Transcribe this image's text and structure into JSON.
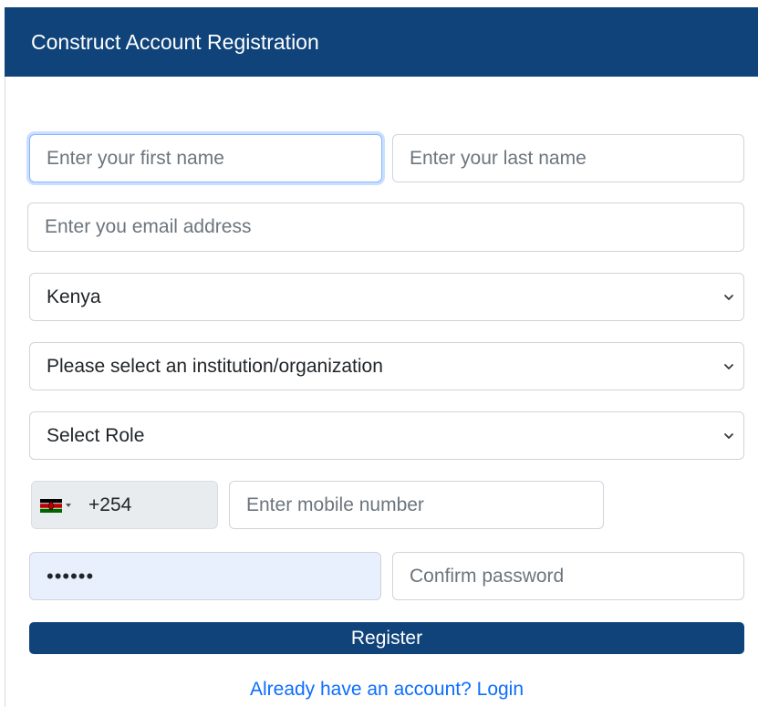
{
  "header": {
    "title": "Construct Account Registration"
  },
  "form": {
    "first_name_placeholder": "Enter your first name",
    "last_name_placeholder": "Enter your last name",
    "email_placeholder": "Enter you email address",
    "country_selected": "Kenya",
    "institution_selected": "Please select an institution/organization",
    "role_selected": "Select Role",
    "phone_dial_code": "+254",
    "phone_flag_icon": "kenya-flag-icon",
    "mobile_placeholder": "Enter mobile number",
    "password_value": "••••••",
    "confirm_password_placeholder": "Confirm password",
    "register_label": "Register",
    "login_link_label": "Already have an account? Login"
  },
  "colors": {
    "brand": "#0f437a",
    "link": "#0d6efd",
    "autofill_bg": "#e8f0fe",
    "prefix_bg": "#e9ecef"
  }
}
